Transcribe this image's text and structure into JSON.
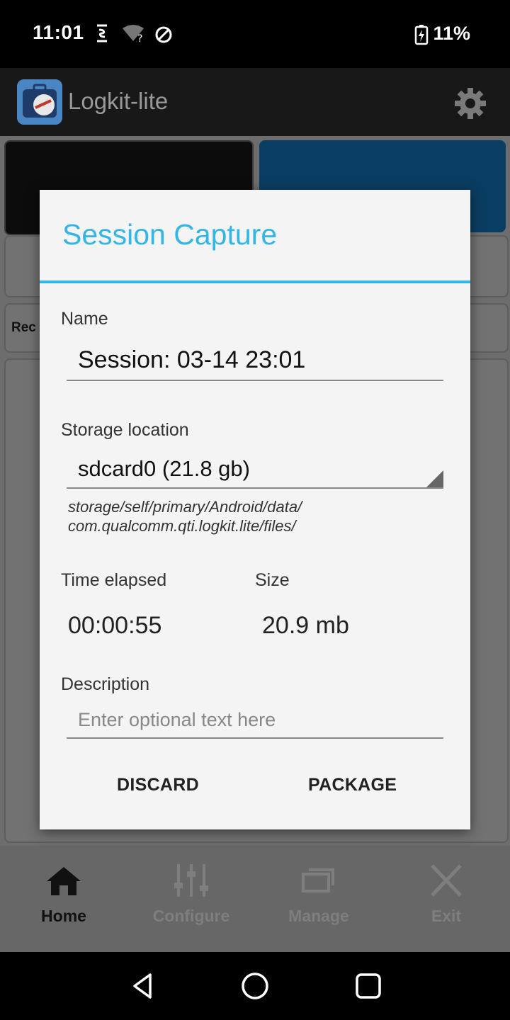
{
  "status_bar": {
    "time": "11:01",
    "battery_pct": "11%"
  },
  "app_bar": {
    "title": "Logkit-lite"
  },
  "background": {
    "recent_label_fragment": "Rec"
  },
  "dialog": {
    "title": "Session Capture",
    "name_label": "Name",
    "name_value": "Session: 03-14 23:01",
    "storage_label": "Storage location",
    "storage_value": "sdcard0 (21.8 gb)",
    "storage_path_line1": "storage/self/primary/Android/data/",
    "storage_path_line2": "com.qualcomm.qti.logkit.lite/files/",
    "time_label": "Time elapsed",
    "time_value": "00:00:55",
    "size_label": "Size",
    "size_value": "20.9 mb",
    "description_label": "Description",
    "description_placeholder": "Enter optional text here",
    "discard_label": "DISCARD",
    "package_label": "PACKAGE"
  },
  "bottom_nav": {
    "items": [
      {
        "label": "Home",
        "icon": "home-icon"
      },
      {
        "label": "Configure",
        "icon": "sliders-icon"
      },
      {
        "label": "Manage",
        "icon": "folder-icon"
      },
      {
        "label": "Exit",
        "icon": "close-icon"
      }
    ]
  },
  "colors": {
    "accent": "#33b5e5",
    "dialog_bg": "#f4f4f4"
  }
}
